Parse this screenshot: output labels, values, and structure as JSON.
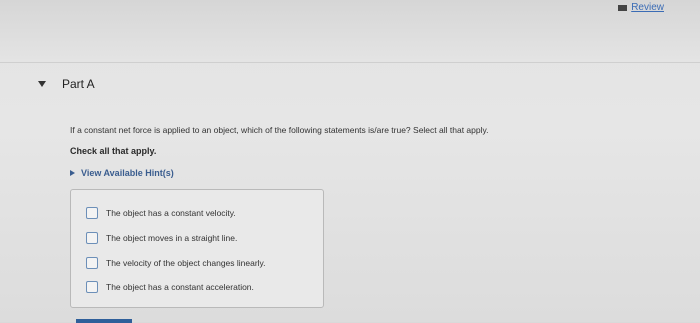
{
  "header": {
    "review_label": "Review"
  },
  "part": {
    "title": "Part A"
  },
  "question": {
    "text": "If a constant net force is applied to an object, which of the following statements is/are true? Select all that apply.",
    "instruction": "Check all that apply.",
    "hints_label": "View Available Hint(s)"
  },
  "options": [
    {
      "label": "The object has a constant velocity.",
      "checked": false
    },
    {
      "label": "The object moves in a straight line.",
      "checked": false
    },
    {
      "label": "The velocity of the object changes linearly.",
      "checked": false
    },
    {
      "label": "The object has a constant acceleration.",
      "checked": false
    }
  ],
  "colors": {
    "link": "#3b6cb5",
    "hint": "#3a5d8f",
    "checkbox_border": "#6c8fb8",
    "button": "#2f5f9a"
  }
}
